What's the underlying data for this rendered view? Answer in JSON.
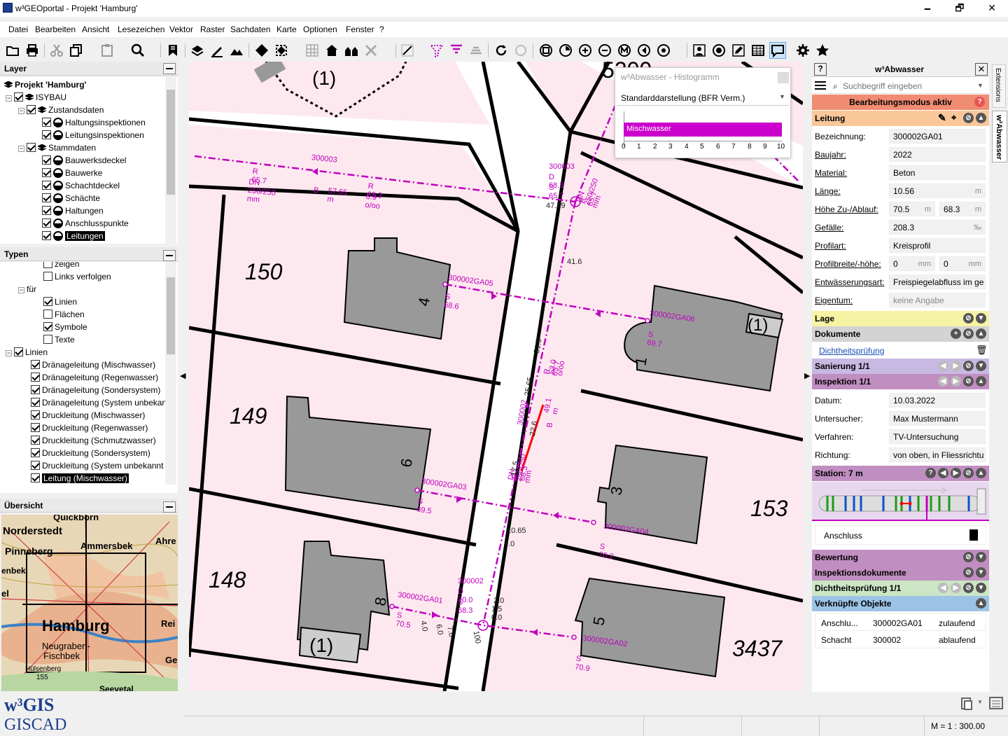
{
  "window": {
    "title": "w³GEOportal - Projekt 'Hamburg'",
    "min": "🗕",
    "max": "🗗",
    "close": "✕"
  },
  "menu": [
    "Datei",
    "Bearbeiten",
    "Ansicht",
    "Lesezeichen",
    "Vektor",
    "Raster",
    "Sachdaten",
    "Karte",
    "Optionen",
    "Fenster",
    "?"
  ],
  "layer_panel": {
    "title": "Layer",
    "items": [
      "Projekt 'Hamburg'",
      "ISYBAU",
      "Zustandsdaten",
      "Haltungsinspektionen",
      "Leitungsinspektionen",
      "Stammdaten",
      "Bauwerksdeckel",
      "Bauwerke",
      "Schachtdeckel",
      "Schächte",
      "Haltungen",
      "Anschlusspunkte",
      "Leitungen"
    ]
  },
  "types_panel": {
    "title": "Typen",
    "items": [
      "zeigen",
      "Links verfolgen",
      "für",
      "Linien",
      "Flächen",
      "Symbole",
      "Texte",
      "Linien",
      "Dränageleitung (Mischwasser)",
      "Dränageleitung (Regenwasser)",
      "Dränageleitung (Sondersystem)",
      "Dränageleitung (System unbekan",
      "Druckleitung (Mischwasser)",
      "Druckleitung (Regenwasser)",
      "Druckleitung (Schmutzwasser)",
      "Druckleitung (Sondersystem)",
      "Druckleitung (System unbekannt",
      "Leitung (Mischwasser)"
    ]
  },
  "overview_panel": {
    "title": "Übersicht",
    "labels": [
      "Quickborn",
      "Norderstedt",
      "Pinneberg",
      "Ammersbek",
      "Ahre",
      "enbek",
      "el",
      "Hamburg",
      "Rei",
      "Neugraben-",
      "Fischbek",
      "Ge",
      "Hülsenberg",
      "155",
      "Seevetal"
    ]
  },
  "logos": {
    "top": "w³GIS",
    "bottom": "GISCAD"
  },
  "map": {
    "parcels": [
      "150",
      "149",
      "148",
      "153",
      "3437",
      "5200",
      "(1)",
      "(1)",
      "(1)"
    ],
    "housenos": [
      "4",
      "6",
      "8",
      "1",
      "3",
      "5"
    ],
    "labels": {
      "top_pipe": "300003",
      "top_r1": "R 65.7",
      "top_dn": "DN 250/250 mm",
      "top_b": "B",
      "top_len": "57.65 m",
      "top_r2": "R 65.3",
      "top_slope": "6.9 o/oo",
      "shaft1": "300003",
      "shaft1_d": "D 68.3",
      "shaft1_s": "S 65.7",
      "s1_r": "R 65.7",
      "s1_dn": "DN 250/250 mm",
      "dist_4779": "47.79",
      "dist_416": "41.6",
      "ga05": "300002GA05",
      "ga05_s": "S 68.6",
      "ga06": "300002GA06",
      "ga06_s": "S 69.7",
      "st310": "31.0",
      "st2565": "25.65",
      "st226": "22.6",
      "st175": "17.5",
      "main_id": "300002",
      "main_r": "R 65.7",
      "main_slope": "53.0 o/oo",
      "main_len": "49.1 m",
      "main_b": "B",
      "main_r2": "R 68.3",
      "main_dn": "DN 250/250 mm",
      "ga03": "300002GA03",
      "ga03_s": "S 69.5",
      "ga04": "300002GA04",
      "ga04_s": "S 70.2",
      "st1065": "10.65",
      "st90": "9.0",
      "shaft2": "300002",
      "shaft2_d": "D 70.0",
      "shaft2_s": "S 68.3",
      "st20": "2.0",
      "st15": "1.5",
      "st00": "0.0",
      "ga01": "300002GA01",
      "ga01_s": "S 70.5",
      "ga02": "300002GA02",
      "ga02_s": "S 70.9",
      "st40": "4.0",
      "st60": "6.0",
      "st70": "7.0",
      "st100": "100"
    }
  },
  "histogram": {
    "title": "w³Abwasser - Histogramm",
    "dropdown": "Standarddarstellung (BFR Verm.)",
    "bar_label": "Mischwasser",
    "bar_value": 10,
    "bar_color": "#cc00cc",
    "ticks": [
      "0",
      "1",
      "2",
      "3",
      "4",
      "5",
      "6",
      "7",
      "8",
      "9",
      "10"
    ]
  },
  "right_panel": {
    "help": "?",
    "title": "w³Abwasser",
    "close": "✕",
    "search_placeholder": "Suchbegriff eingeben",
    "edit_mode": "Bearbeitungsmodus aktiv",
    "section_leitung": "Leitung",
    "fields": [
      {
        "label": "Bezeichnung:",
        "value": "300002GA01",
        "unit": "",
        "underline": false
      },
      {
        "label": "Baujahr:",
        "value": "2022",
        "unit": "",
        "underline": true
      },
      {
        "label": "Material:",
        "value": "Beton",
        "unit": "",
        "underline": true
      },
      {
        "label": "Länge:",
        "value": "10.56",
        "unit": "m",
        "underline": true
      },
      {
        "label": "Profilart:",
        "value": "Kreisprofil",
        "unit": "",
        "underline": true
      },
      {
        "label": "Entwässerungsart:",
        "value": "Freispiegelabfluss im ge",
        "unit": "",
        "underline": true
      },
      {
        "label": "Eigentum:",
        "value": "keine Angabe",
        "unit": "",
        "underline": true
      }
    ],
    "hoehe": {
      "label": "Höhe Zu-/Ablauf:",
      "v1": "70.5",
      "u1": "m",
      "v2": "68.3",
      "u2": "m"
    },
    "gefaelle": {
      "label": "Gefälle:",
      "value": "208.3",
      "unit": "‰"
    },
    "profil": {
      "label": "Profilbreite/-höhe:",
      "v1": "0",
      "u1": "mm",
      "v2": "0",
      "u2": "mm"
    },
    "section_lage": "Lage",
    "section_dokumente": "Dokumente",
    "doc_link": "Dichtheitsprüfung",
    "section_sanierung": "Sanierung 1/1",
    "section_inspektion": "Inspektion 1/1",
    "inspektion": [
      {
        "label": "Datum:",
        "value": "10.03.2022"
      },
      {
        "label": "Untersucher:",
        "value": "Max Mustermann"
      },
      {
        "label": "Verfahren:",
        "value": "TV-Untersuchung"
      },
      {
        "label": "Richtung:",
        "value": "von oben, in Fliessrichtu"
      }
    ],
    "section_station": "Station: 7 m",
    "anschluss": "Anschluss",
    "section_bewertung": "Bewertung",
    "section_inspdoc": "Inspektionsdokumente",
    "section_dicht": "Dichtheitsprüfung 1/1",
    "section_verkn": "Verknüpfte Objekte",
    "verkn": [
      {
        "type": "Anschlu...",
        "id": "300002GA01",
        "dir": "zulaufend"
      },
      {
        "type": "Schacht",
        "id": "300002",
        "dir": "ablaufend"
      }
    ]
  },
  "side_tabs": [
    "Extensions",
    "w³Abwasser"
  ],
  "status": {
    "scale": "M = 1 :  300.00"
  },
  "colors": {
    "leitung_bg": "#f9c79a",
    "edit_bg": "#f08c72",
    "lage_bg": "#f7f3a5",
    "doc_bg": "#d3d3d3",
    "sanierung_bg": "#c8b9e3",
    "inspektion_bg": "#c08ec0",
    "dicht_bg": "#cce5c4",
    "verkn_bg": "#9bc3e6",
    "pipe": "#c000c0"
  }
}
